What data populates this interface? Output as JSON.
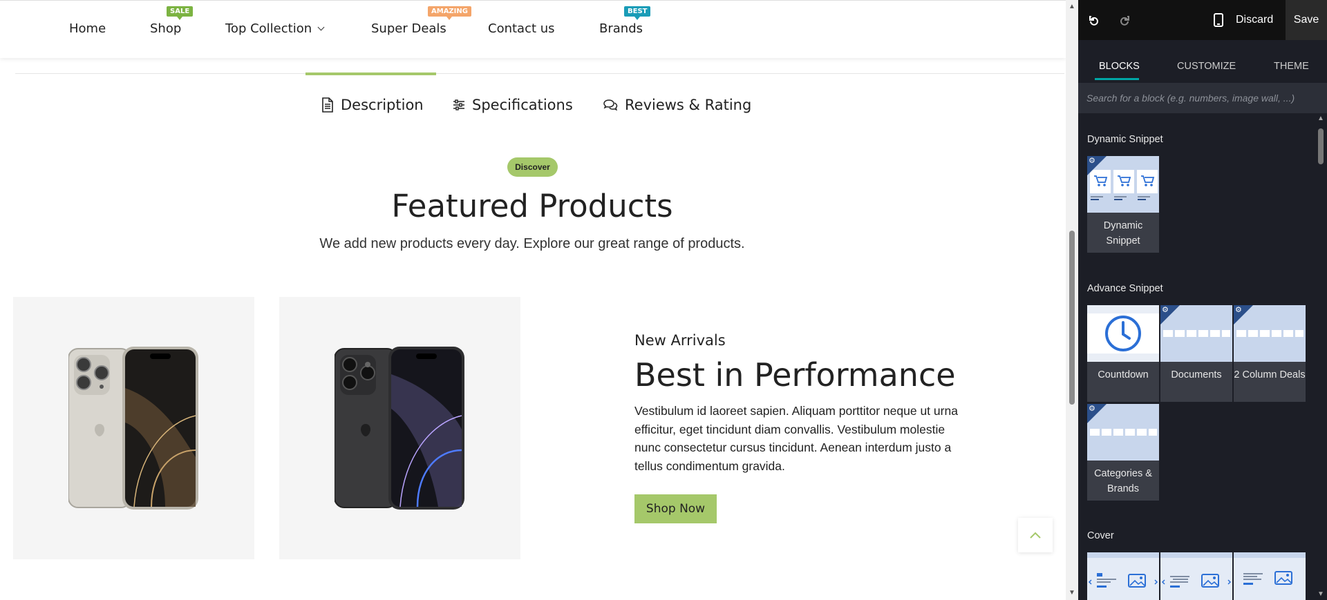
{
  "nav": {
    "items": [
      {
        "label": "Home",
        "badge": ""
      },
      {
        "label": "Shop",
        "badge": "SALE"
      },
      {
        "label": "Top Collection",
        "badge": ""
      },
      {
        "label": "Super Deals",
        "badge": "AMAZING"
      },
      {
        "label": "Contact us",
        "badge": ""
      },
      {
        "label": "Brands",
        "badge": "BEST"
      }
    ]
  },
  "tabs": [
    {
      "label": "Description",
      "icon": "document-icon",
      "active": true
    },
    {
      "label": "Specifications",
      "icon": "sliders-icon",
      "active": false
    },
    {
      "label": "Reviews & Rating",
      "icon": "chat-icon",
      "active": false
    }
  ],
  "featured": {
    "badge": "Discover",
    "title": "Featured Products",
    "subtitle": "We add new products every day. Explore our great range of products."
  },
  "promo": {
    "label": "New Arrivals",
    "title": "Best in Performance",
    "body": "Vestibulum id laoreet sapien. Aliquam porttitor neque ut urna efficitur, eget tincidunt diam convallis. Vestibulum molestie nunc consectetur cursus tincidunt. Aenean interdum justo a tellus condimentum gravida.",
    "button": "Shop Now"
  },
  "products": [
    {
      "name": "phone-natural-titanium",
      "color": "#d9d6cf"
    },
    {
      "name": "phone-black-titanium",
      "color": "#3a3a3c"
    }
  ],
  "editor": {
    "discard": "Discard",
    "save": "Save",
    "tabs": [
      "BLOCKS",
      "CUSTOMIZE",
      "THEME"
    ],
    "search_placeholder": "Search for a block (e.g. numbers, image wall, ...)",
    "sections": {
      "dynamic": {
        "title": "Dynamic Snippet",
        "blocks": [
          {
            "label": "Dynamic Snippet"
          }
        ]
      },
      "advance": {
        "title": "Advance Snippet",
        "blocks": [
          {
            "label": "Countdown"
          },
          {
            "label": "Documents"
          },
          {
            "label": "2 Column Deals"
          },
          {
            "label": "Categories & Brands"
          }
        ]
      },
      "cover": {
        "title": "Cover"
      }
    }
  },
  "colors": {
    "accent_green": "#a5c86a",
    "editor_bg": "#1c1e26",
    "editor_tab_underline": "#00a6a6",
    "block_thumb": "#c8d6ec"
  }
}
